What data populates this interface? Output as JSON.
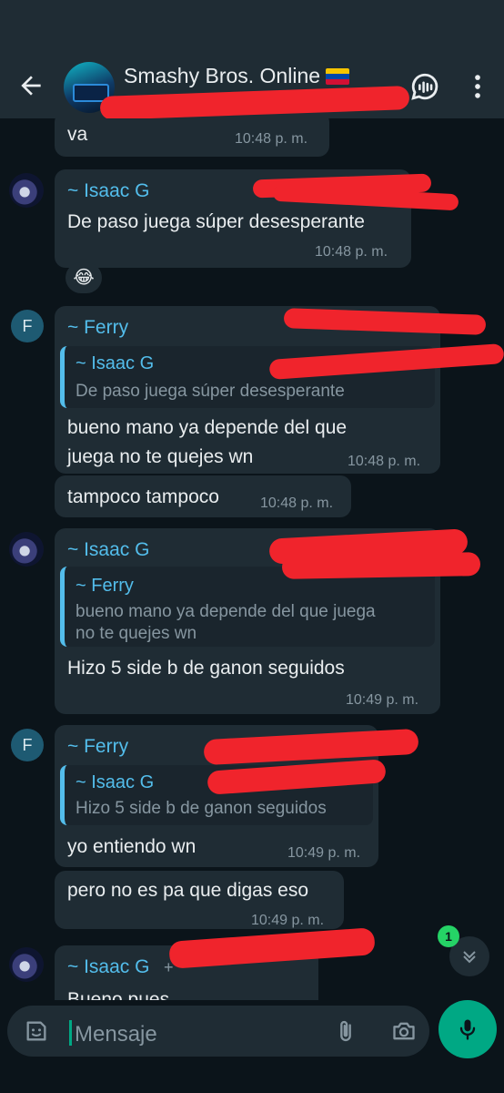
{
  "header": {
    "title": "Smashy Bros. Online"
  },
  "messages": [
    {
      "text": "va",
      "time": "10:48 p. m."
    },
    {
      "sender": "~ Isaac G",
      "text": "De paso juega súper desesperante",
      "time": "10:48 p. m.",
      "reaction": "😂"
    },
    {
      "sender": "~ Ferry",
      "quote_name": "~ Isaac G",
      "quote_text": "De paso juega súper desesperante",
      "line1": "bueno mano ya depende del que",
      "line2": "juega no te quejes wn",
      "time": "10:48 p. m."
    },
    {
      "text": "tampoco tampoco",
      "time": "10:48 p. m."
    },
    {
      "sender": "~ Isaac G",
      "quote_name": "~ Ferry",
      "quote_line1": "bueno mano ya depende del que juega",
      "quote_line2": "no te quejes wn",
      "text": "Hizo 5 side b de ganon seguidos",
      "time": "10:49 p. m."
    },
    {
      "sender": "~ Ferry",
      "quote_name": "~ Isaac G",
      "quote_text": "Hizo 5 side b de ganon seguidos",
      "text": "yo entiendo wn",
      "time": "10:49 p. m."
    },
    {
      "text": "pero no es pa que digas eso",
      "time": "10:49 p. m."
    },
    {
      "sender": "~ Isaac G",
      "sender_extra": "+",
      "text": "Bueno pues"
    }
  ],
  "avatars": {
    "ferry_initial": "F"
  },
  "scroll": {
    "unread_count": "1"
  },
  "composer": {
    "placeholder": "Mensaje"
  },
  "colors": {
    "accent": "#00a884",
    "sender": "#53bdeb",
    "redaction": "#f0242c"
  }
}
